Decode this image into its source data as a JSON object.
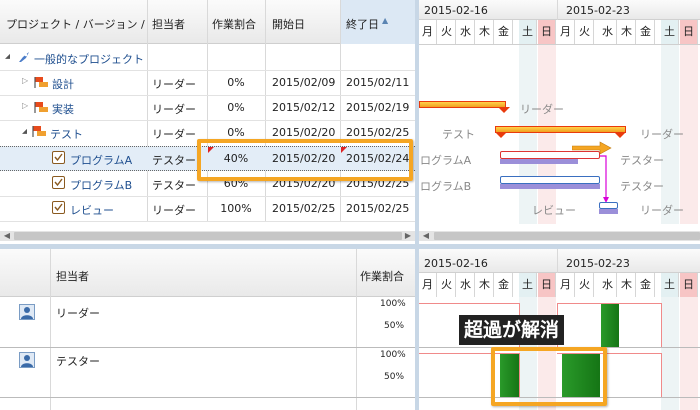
{
  "grid": {
    "columns": [
      "プロジェクト / バージョン / ...",
      "担当者",
      "作業割合",
      "開始日",
      "終了日"
    ],
    "sort_indicator": "▲",
    "rows": [
      {
        "name": "一般的なプロジェクト",
        "assignee": "",
        "progress": "",
        "start": "",
        "end": "",
        "icon": "rocket-icon",
        "toggle": "◢"
      },
      {
        "name": "設計",
        "assignee": "リーダー",
        "progress": "0%",
        "start": "2015/02/09",
        "end": "2015/02/11",
        "icon": "version-icon",
        "toggle": "▷"
      },
      {
        "name": "実装",
        "assignee": "リーダー",
        "progress": "0%",
        "start": "2015/02/12",
        "end": "2015/02/19",
        "icon": "version-icon",
        "toggle": "▷"
      },
      {
        "name": "テスト",
        "assignee": "リーダー",
        "progress": "0%",
        "start": "2015/02/20",
        "end": "2015/02/25",
        "icon": "version-icon",
        "toggle": "◢"
      },
      {
        "name": "プログラムA",
        "assignee": "テスター",
        "progress": "40%",
        "start": "2015/02/20",
        "end": "2015/02/24",
        "icon": "task-icon",
        "toggle": ""
      },
      {
        "name": "プログラムB",
        "assignee": "テスター",
        "progress": "60%",
        "start": "2015/02/20",
        "end": "2015/02/25",
        "icon": "task-icon",
        "toggle": ""
      },
      {
        "name": "レビュー",
        "assignee": "リーダー",
        "progress": "100%",
        "start": "2015/02/25",
        "end": "2015/02/25",
        "icon": "task-icon",
        "toggle": ""
      }
    ]
  },
  "gantt": {
    "week1": "2015-02-16",
    "week2": "2015-02-23",
    "days": [
      "月",
      "火",
      "水",
      "木",
      "金",
      "土",
      "日",
      "月",
      "火",
      "水",
      "木",
      "金",
      "土",
      "日"
    ],
    "labels": {
      "implement_right": "リーダー",
      "test_left": "テスト",
      "test_right": "リーダー",
      "progA_left": "ログラムA",
      "progA_right": "テスター",
      "progB_left": "ログラムB",
      "progB_right": "テスター",
      "review_left": "レビュー",
      "review_right": "リーダー"
    }
  },
  "resource": {
    "columns": [
      "担当者",
      "作業割合"
    ],
    "rows": [
      {
        "name": "リーダー",
        "pct_100": "100%",
        "pct_50": "50%"
      },
      {
        "name": "テスター",
        "pct_100": "100%",
        "pct_50": "50%"
      }
    ]
  },
  "callout": "超過が解消",
  "colors": {
    "highlight": "#f5a623",
    "selected_row": "#e3edf7",
    "version_bar": "#e93a0c",
    "task_bar_border": "#d33",
    "progress_bar": "#9b8fd9",
    "load_bar": "#1e8a1e",
    "dependency": "#d800d8"
  }
}
